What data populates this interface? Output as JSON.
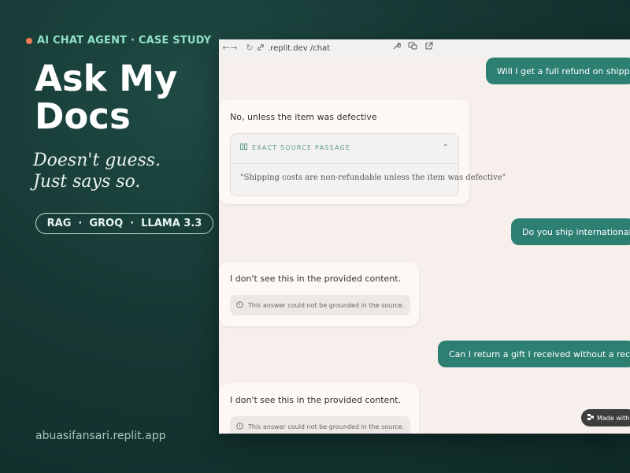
{
  "header": {
    "eyebrow": "AI CHAT AGENT · CASE STUDY",
    "title": "Ask My Docs",
    "tagline_line1": "Doesn't guess.",
    "tagline_line2": "Just says so.",
    "tech": [
      "RAG",
      "GROQ",
      "LLAMA 3.3"
    ],
    "separator": "·"
  },
  "footer_url": "abuasifansari.replit.app",
  "browser": {
    "url": ".replit.dev /chat",
    "icons": [
      "back-arrow-icon",
      "forward-arrow-icon",
      "reload-icon",
      "link-icon",
      "wrench-icon",
      "chat-overlay-icon",
      "open-external-icon"
    ]
  },
  "chat": {
    "q1": "Will I get a full refund on shipping?",
    "a1": "No, unless the item was defective",
    "source_label": "EXACT SOURCE PASSAGE",
    "source_quote": "\"Shipping costs are non-refundable unless the item was defective\"",
    "q2": "Do you ship internationally?",
    "a2": "I don't see this in the provided content.",
    "notice": "This answer could not be grounded in the source.",
    "q3": "Can I return a gift I received without a receipt?",
    "a3": "I don't see this in the provided content.",
    "notice2": "This answer could not be grounded in the source."
  },
  "badge": {
    "label": "Made with"
  },
  "colors": {
    "accent": "#2d7f72",
    "eyebrow": "#8fe0c6",
    "dot": "#f07a5a",
    "background": "#163733"
  }
}
